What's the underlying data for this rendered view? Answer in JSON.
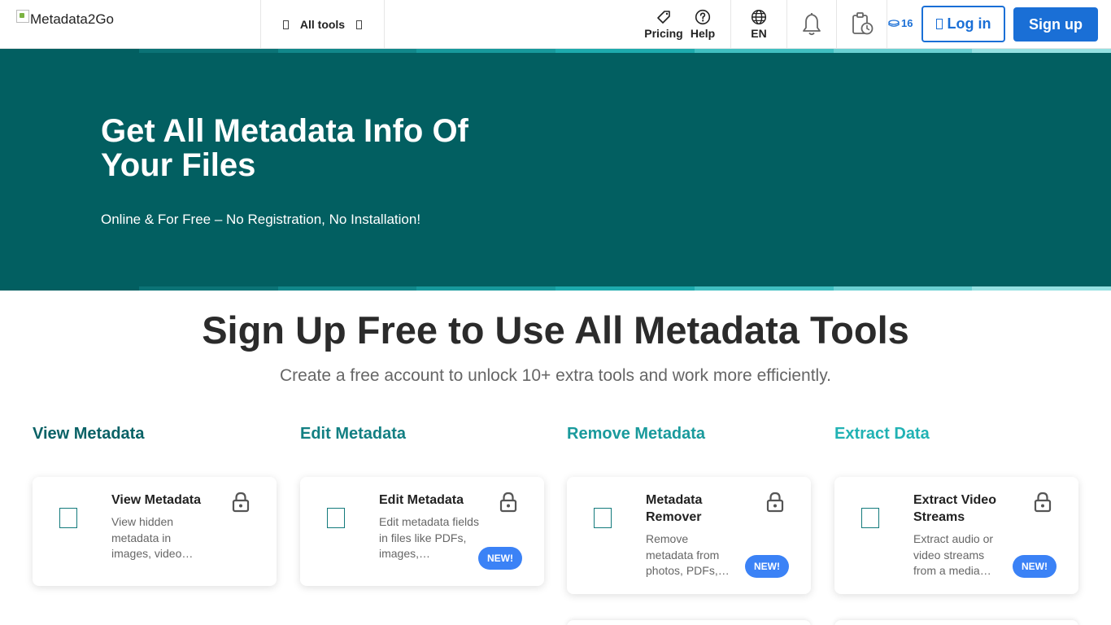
{
  "header": {
    "logo_alt": "Metadata2Go",
    "all_tools": "All tools",
    "pricing": "Pricing",
    "help": "Help",
    "language": "EN",
    "credits": "16",
    "login": "Log in",
    "signup": "Sign up"
  },
  "hero": {
    "title": "Get All Metadata Info Of Your Files",
    "subtitle": "Online & For Free – No Registration, No Installation!"
  },
  "signup_section": {
    "title": "Sign Up Free to Use All Metadata Tools",
    "subtitle": "Create a free account to unlock 10+ extra tools and work more efficiently."
  },
  "categories": [
    {
      "label": "View Metadata",
      "color": "#0a6266"
    },
    {
      "label": "Edit Metadata",
      "color": "#127f82"
    },
    {
      "label": "Remove Metadata",
      "color": "#199a9c"
    },
    {
      "label": "Extract Data",
      "color": "#21b2b4"
    }
  ],
  "cards": [
    {
      "title": "View Metadata",
      "desc": "View hidden metadata in images, video…",
      "badge": ""
    },
    {
      "title": "Edit Metadata",
      "desc": "Edit metadata fields in files like PDFs, images,…",
      "badge": "NEW!"
    },
    {
      "title": "Metadata Remover",
      "desc": "Remove metadata from photos, PDFs,…",
      "badge": "NEW!"
    },
    {
      "title": "Extract Video Streams",
      "desc": "Extract audio or video streams from a media…",
      "badge": "NEW!"
    }
  ],
  "colors": {
    "hero_bg": "#025f61",
    "accent_blue": "#1a6fd6",
    "badge_blue": "#3b82f6",
    "stripe": [
      "#025f61",
      "#0b7376",
      "#11878a",
      "#17999c",
      "#1daaad",
      "#40bfc1",
      "#6ad0d2",
      "#95e0e1"
    ]
  }
}
